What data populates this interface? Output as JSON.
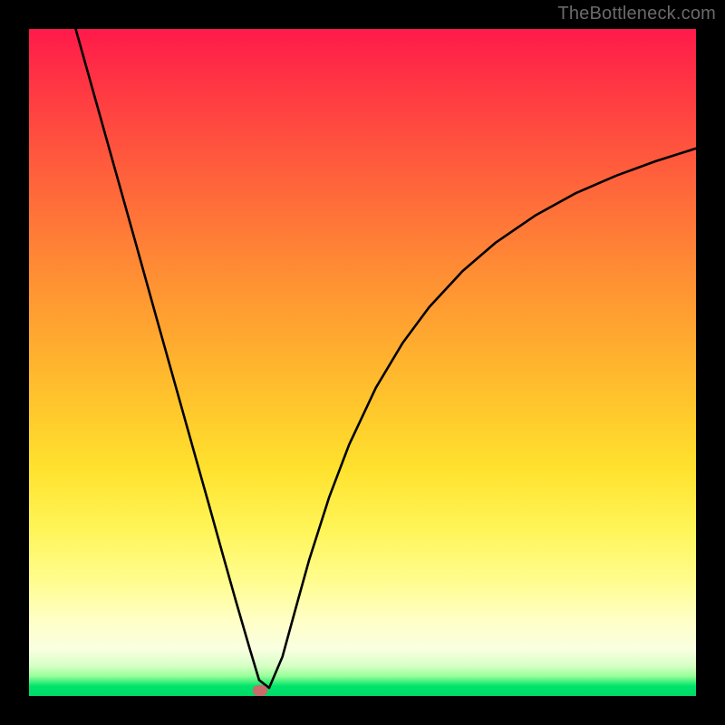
{
  "watermark": "TheBottleneck.com",
  "colors": {
    "frame": "#000000",
    "curve": "#000000",
    "marker": "#c96b6b",
    "gradient_stops": [
      "#ff1a4a",
      "#ff8c34",
      "#ffe22e",
      "#ffffc9",
      "#00d86a"
    ]
  },
  "chart_data": {
    "type": "line",
    "title": "",
    "xlabel": "",
    "ylabel": "",
    "xlim": [
      0,
      100
    ],
    "ylim": [
      0,
      100
    ],
    "grid": false,
    "series": [
      {
        "name": "bottleneck-curve",
        "x": [
          7,
          10,
          13,
          16,
          19,
          22,
          25,
          27,
          29,
          31,
          33,
          34.5,
          36,
          38,
          40,
          42,
          45,
          48,
          52,
          56,
          60,
          65,
          70,
          76,
          82,
          88,
          94,
          100
        ],
        "y": [
          100,
          89.3,
          78.6,
          67.9,
          57.1,
          46.4,
          35.7,
          28.6,
          21.4,
          14.3,
          7.4,
          2.4,
          1.2,
          5.9,
          13.2,
          20.4,
          29.8,
          37.7,
          46.2,
          52.9,
          58.3,
          63.7,
          68.0,
          72.1,
          75.4,
          78.0,
          80.2,
          82.1
        ]
      }
    ],
    "marker": {
      "x": 34.6,
      "y": 0.8
    },
    "legend": false
  }
}
